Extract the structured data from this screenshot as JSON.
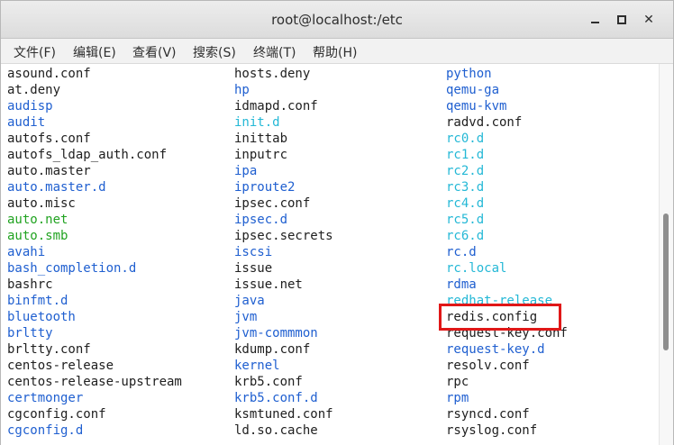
{
  "window": {
    "title": "root@localhost:/etc"
  },
  "menu": [
    "文件(F)",
    "编辑(E)",
    "查看(V)",
    "搜索(S)",
    "终端(T)",
    "帮助(H)"
  ],
  "columns": [
    [
      {
        "text": "asound.conf",
        "type": "file"
      },
      {
        "text": "at.deny",
        "type": "file"
      },
      {
        "text": "audisp",
        "type": "dir"
      },
      {
        "text": "audit",
        "type": "dir"
      },
      {
        "text": "autofs.conf",
        "type": "file"
      },
      {
        "text": "autofs_ldap_auth.conf",
        "type": "file"
      },
      {
        "text": "auto.master",
        "type": "file"
      },
      {
        "text": "auto.master.d",
        "type": "dir"
      },
      {
        "text": "auto.misc",
        "type": "file"
      },
      {
        "text": "auto.net",
        "type": "exec"
      },
      {
        "text": "auto.smb",
        "type": "exec"
      },
      {
        "text": "avahi",
        "type": "dir"
      },
      {
        "text": "bash_completion.d",
        "type": "dir"
      },
      {
        "text": "bashrc",
        "type": "file"
      },
      {
        "text": "binfmt.d",
        "type": "dir"
      },
      {
        "text": "bluetooth",
        "type": "dir"
      },
      {
        "text": "brltty",
        "type": "dir"
      },
      {
        "text": "brltty.conf",
        "type": "file"
      },
      {
        "text": "centos-release",
        "type": "file"
      },
      {
        "text": "centos-release-upstream",
        "type": "file"
      },
      {
        "text": "certmonger",
        "type": "dir"
      },
      {
        "text": "cgconfig.conf",
        "type": "file"
      },
      {
        "text": "cgconfig.d",
        "type": "dir"
      }
    ],
    [
      {
        "text": "hosts.deny",
        "type": "file"
      },
      {
        "text": "hp",
        "type": "dir"
      },
      {
        "text": "idmapd.conf",
        "type": "file"
      },
      {
        "text": "init.d",
        "type": "link"
      },
      {
        "text": "inittab",
        "type": "file"
      },
      {
        "text": "inputrc",
        "type": "file"
      },
      {
        "text": "ipa",
        "type": "dir"
      },
      {
        "text": "iproute2",
        "type": "dir"
      },
      {
        "text": "ipsec.conf",
        "type": "file"
      },
      {
        "text": "ipsec.d",
        "type": "dir"
      },
      {
        "text": "ipsec.secrets",
        "type": "file"
      },
      {
        "text": "iscsi",
        "type": "dir"
      },
      {
        "text": "issue",
        "type": "file"
      },
      {
        "text": "issue.net",
        "type": "file"
      },
      {
        "text": "java",
        "type": "dir"
      },
      {
        "text": "jvm",
        "type": "dir"
      },
      {
        "text": "jvm-commmon",
        "type": "dir"
      },
      {
        "text": "kdump.conf",
        "type": "file"
      },
      {
        "text": "kernel",
        "type": "dir"
      },
      {
        "text": "krb5.conf",
        "type": "file"
      },
      {
        "text": "krb5.conf.d",
        "type": "dir"
      },
      {
        "text": "ksmtuned.conf",
        "type": "file"
      },
      {
        "text": "ld.so.cache",
        "type": "file"
      }
    ],
    [
      {
        "text": "python",
        "type": "dir"
      },
      {
        "text": "qemu-ga",
        "type": "dir"
      },
      {
        "text": "qemu-kvm",
        "type": "dir"
      },
      {
        "text": "radvd.conf",
        "type": "file"
      },
      {
        "text": "rc0.d",
        "type": "link"
      },
      {
        "text": "rc1.d",
        "type": "link"
      },
      {
        "text": "rc2.d",
        "type": "link"
      },
      {
        "text": "rc3.d",
        "type": "link"
      },
      {
        "text": "rc4.d",
        "type": "link"
      },
      {
        "text": "rc5.d",
        "type": "link"
      },
      {
        "text": "rc6.d",
        "type": "link"
      },
      {
        "text": "rc.d",
        "type": "dir"
      },
      {
        "text": "rc.local",
        "type": "link"
      },
      {
        "text": "rdma",
        "type": "dir"
      },
      {
        "text": "redhat-release",
        "type": "link"
      },
      {
        "text": "redis.config",
        "type": "file"
      },
      {
        "text": "request-key.conf",
        "type": "file"
      },
      {
        "text": "request-key.d",
        "type": "dir"
      },
      {
        "text": "resolv.conf",
        "type": "file"
      },
      {
        "text": "rpc",
        "type": "file"
      },
      {
        "text": "rpm",
        "type": "dir"
      },
      {
        "text": "rsyncd.conf",
        "type": "file"
      },
      {
        "text": "rsyslog.conf",
        "type": "file"
      }
    ]
  ],
  "highlighted_file": "redis.config",
  "colors": {
    "dir": "#1f5fd0",
    "link": "#24b8d6",
    "exec": "#21a321",
    "file": "#202020",
    "highlight": "#e01818"
  }
}
